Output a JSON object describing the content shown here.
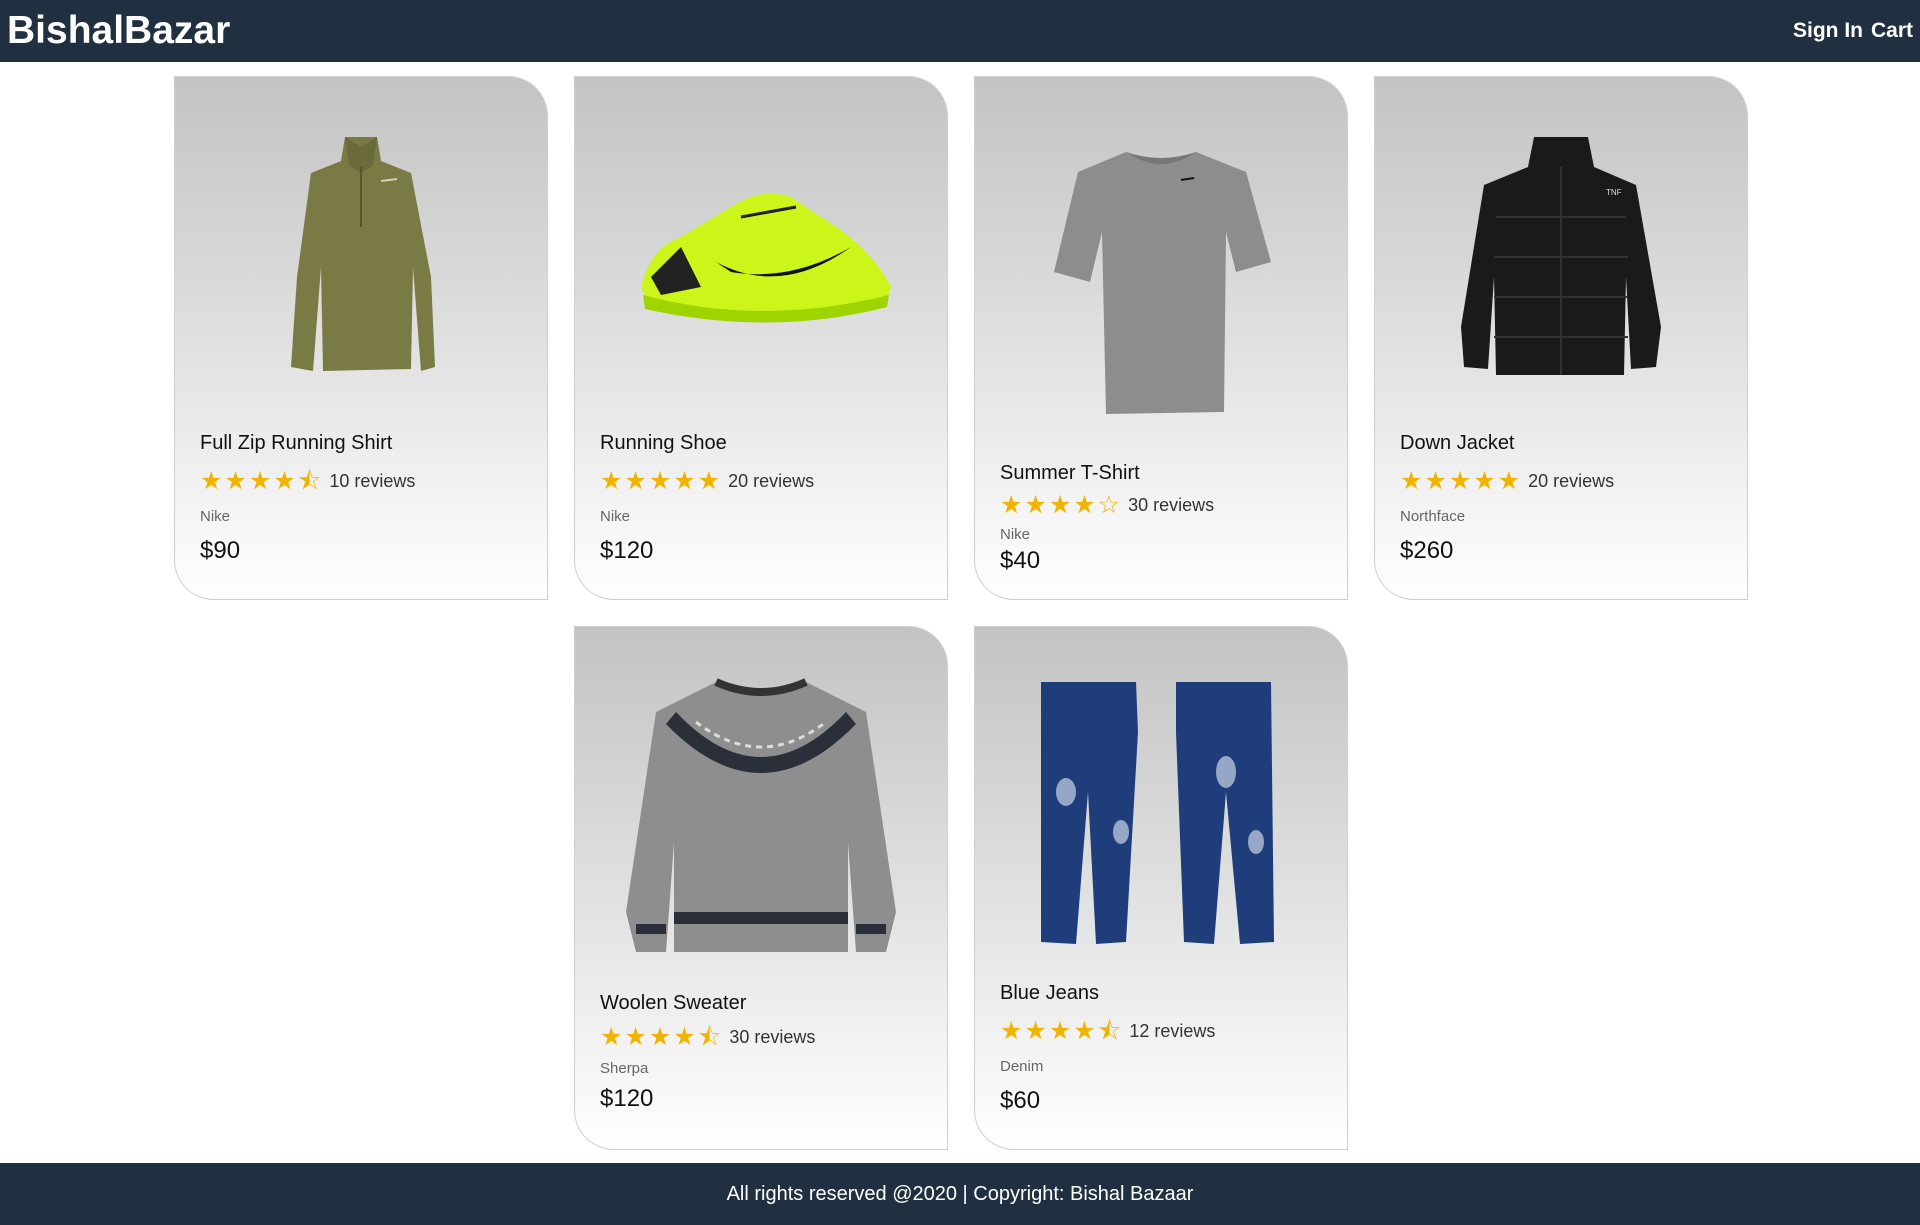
{
  "header": {
    "brand": "BishalBazar",
    "signin": "Sign In",
    "cart": "Cart"
  },
  "products": [
    {
      "name": "Full Zip Running Shirt",
      "stars": "★★★★⯪",
      "reviews": "10 reviews",
      "brand": "Nike",
      "price": "$90"
    },
    {
      "name": "Running Shoe",
      "stars": "★★★★★",
      "reviews": "20 reviews",
      "brand": "Nike",
      "price": "$120"
    },
    {
      "name": "Summer T-Shirt",
      "stars": "★★★★☆",
      "reviews": "30 reviews",
      "brand": "Nike",
      "price": "$40"
    },
    {
      "name": "Down Jacket",
      "stars": "★★★★★",
      "reviews": "20 reviews",
      "brand": "Northface",
      "price": "$260"
    },
    {
      "name": "Woolen Sweater",
      "stars": "★★★★⯪",
      "reviews": "30 reviews",
      "brand": "Sherpa",
      "price": "$120"
    },
    {
      "name": "Blue Jeans",
      "stars": "★★★★⯪",
      "reviews": "12 reviews",
      "brand": "Denim",
      "price": "$60"
    }
  ],
  "footer": {
    "text": "All rights reserved @2020 | Copyright: Bishal Bazaar"
  }
}
